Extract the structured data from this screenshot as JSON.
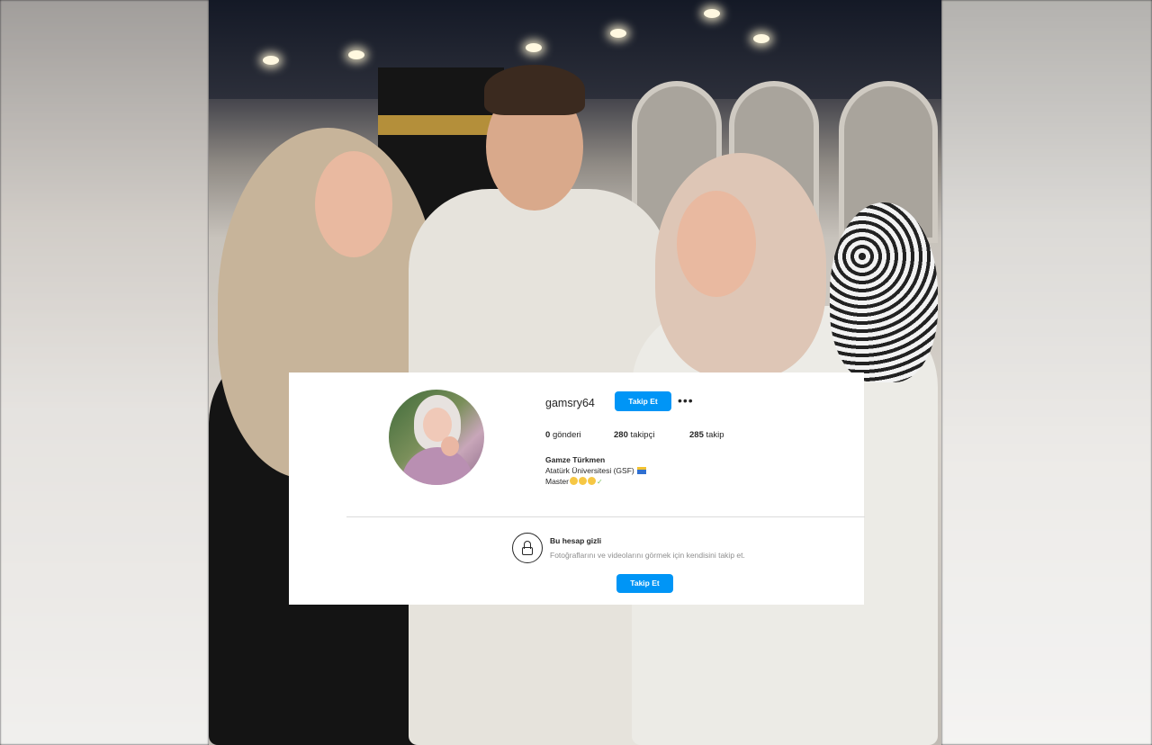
{
  "profile": {
    "username": "gamsry64",
    "follow_label": "Takip Et",
    "more_label": "•••",
    "stats": {
      "posts_count": "0",
      "posts_label": "gönderi",
      "followers_count": "280",
      "followers_label": "takipçi",
      "following_count": "285",
      "following_label": "takip"
    },
    "full_name": "Gamze Türkmen",
    "bio_line1": "Atatürk Üniversitesi (GSF)",
    "bio_line2": "Master"
  },
  "private_notice": {
    "title": "Bu hesap gizli",
    "description": "Fotoğraflarını ve videolarını görmek için kendisini takip et.",
    "follow_label": "Takip Et"
  },
  "colors": {
    "accent": "#0095f6",
    "card_bg": "#ffffff",
    "text_primary": "#262626",
    "text_secondary": "#8e8e8e"
  }
}
